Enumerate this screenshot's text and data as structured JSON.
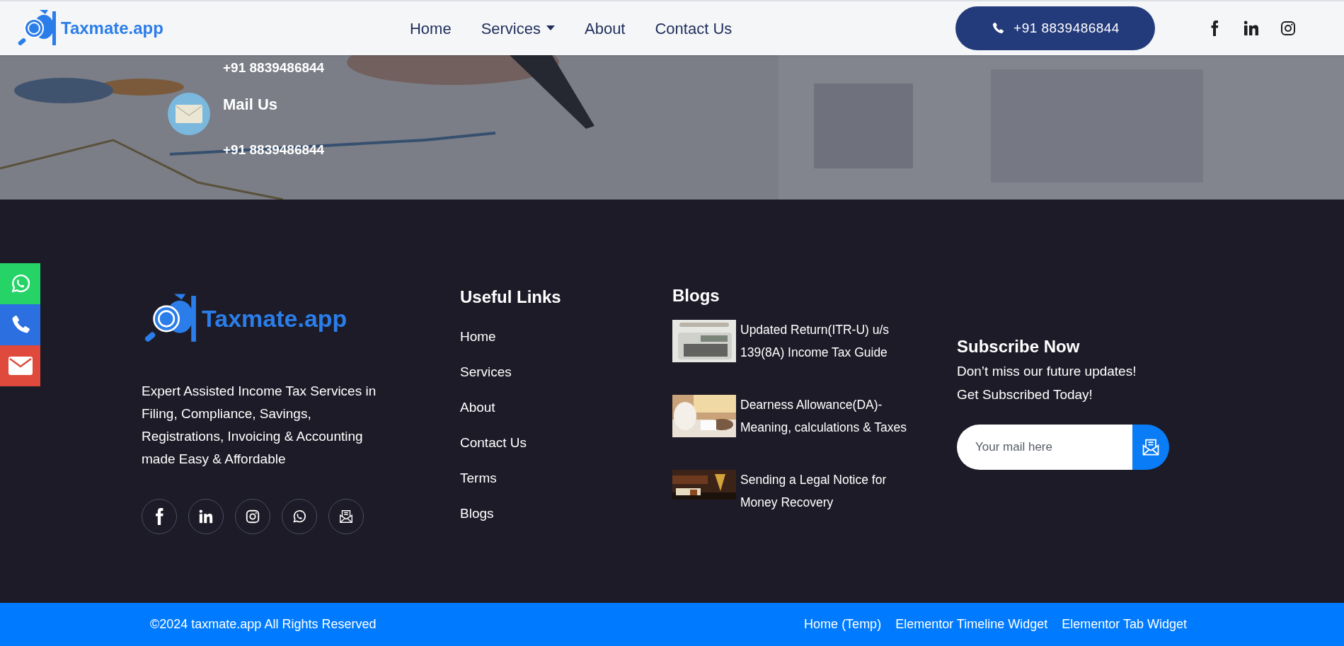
{
  "header": {
    "logo_text": "Taxmate.app",
    "nav": [
      {
        "label": "Home",
        "has_dropdown": false
      },
      {
        "label": "Services",
        "has_dropdown": true
      },
      {
        "label": "About",
        "has_dropdown": false
      },
      {
        "label": "Contact Us",
        "has_dropdown": false
      }
    ],
    "phone_button": "+91 8839486844",
    "socials": [
      {
        "kind": "facebook"
      },
      {
        "kind": "linkedin"
      },
      {
        "kind": "instagram"
      }
    ]
  },
  "hero": {
    "phone_text": "+91 8839486844",
    "mail": {
      "heading": "Mail Us",
      "text": "+91 8839486844"
    }
  },
  "sticky_contact": [
    {
      "kind": "whatsapp",
      "color": "#25d366"
    },
    {
      "kind": "phone",
      "color": "#2b6fe0"
    },
    {
      "kind": "mail",
      "color": "#df4a3c"
    }
  ],
  "footer": {
    "logo_text": "Taxmate.app",
    "description": "Expert Assisted Income Tax Services in Filing, Compliance, Savings, Registrations, Invoicing & Accounting made Easy & Affordable",
    "socials": [
      {
        "kind": "facebook"
      },
      {
        "kind": "linkedin"
      },
      {
        "kind": "instagram"
      },
      {
        "kind": "whatsapp"
      },
      {
        "kind": "mail"
      }
    ],
    "useful_links": {
      "title": "Useful Links",
      "links": [
        "Home",
        "Services",
        "About",
        "Contact Us",
        "Terms",
        "Blogs"
      ]
    },
    "blogs": {
      "title": "Blogs",
      "posts": [
        {
          "title": "Updated Return(ITR-U) u/s 139(8A) Income Tax Guide",
          "kind": "calculator"
        },
        {
          "title": "Dearness Allowance(DA)- Meaning, calculations & Taxes",
          "kind": "desk"
        },
        {
          "title": "Sending a Legal Notice for Money Recovery",
          "kind": "law"
        }
      ]
    },
    "subscribe": {
      "title": "Subscribe Now",
      "lines": [
        "Don’t miss our future updates!",
        "Get Subscribed Today!"
      ],
      "email_field": {
        "placeholder": "Your mail here"
      }
    }
  },
  "bottom_bar": {
    "copyright": "©2024 taxmate.app All Rights Reserved",
    "links": [
      "Home (Temp)",
      "Elementor Timeline Widget",
      "Elementor Tab Widget"
    ]
  }
}
